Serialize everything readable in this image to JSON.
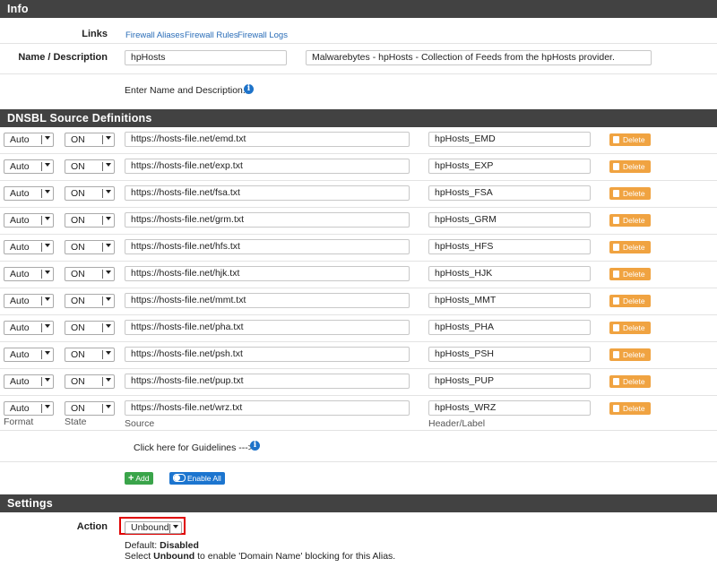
{
  "info": {
    "title": "Info",
    "links_label": "Links",
    "links": [
      "Firewall Aliases",
      "Firewall Rules",
      "Firewall Logs"
    ],
    "name_label": "Name / Description",
    "name_value": "hpHosts",
    "description_value": "Malwarebytes - hpHosts - Collection of Feeds from the hpHosts provider.",
    "hint": "Enter Name and Description.",
    "info_icon": "info-circle-icon"
  },
  "sources": {
    "title": "DNSBL Source Definitions",
    "delete_label": "Delete",
    "rows": [
      {
        "format": "Auto",
        "state": "ON",
        "url": "https://hosts-file.net/emd.txt",
        "label": "hpHosts_EMD"
      },
      {
        "format": "Auto",
        "state": "ON",
        "url": "https://hosts-file.net/exp.txt",
        "label": "hpHosts_EXP"
      },
      {
        "format": "Auto",
        "state": "ON",
        "url": "https://hosts-file.net/fsa.txt",
        "label": "hpHosts_FSA"
      },
      {
        "format": "Auto",
        "state": "ON",
        "url": "https://hosts-file.net/grm.txt",
        "label": "hpHosts_GRM"
      },
      {
        "format": "Auto",
        "state": "ON",
        "url": "https://hosts-file.net/hfs.txt",
        "label": "hpHosts_HFS"
      },
      {
        "format": "Auto",
        "state": "ON",
        "url": "https://hosts-file.net/hjk.txt",
        "label": "hpHosts_HJK"
      },
      {
        "format": "Auto",
        "state": "ON",
        "url": "https://hosts-file.net/mmt.txt",
        "label": "hpHosts_MMT"
      },
      {
        "format": "Auto",
        "state": "ON",
        "url": "https://hosts-file.net/pha.txt",
        "label": "hpHosts_PHA"
      },
      {
        "format": "Auto",
        "state": "ON",
        "url": "https://hosts-file.net/psh.txt",
        "label": "hpHosts_PSH"
      },
      {
        "format": "Auto",
        "state": "ON",
        "url": "https://hosts-file.net/pup.txt",
        "label": "hpHosts_PUP"
      },
      {
        "format": "Auto",
        "state": "ON",
        "url": "https://hosts-file.net/wrz.txt",
        "label": "hpHosts_WRZ"
      }
    ],
    "col_format": "Format",
    "col_state": "State",
    "col_source": "Source",
    "col_header": "Header/Label",
    "guidelines": "Click here for Guidelines --->",
    "add_label": "Add",
    "enable_all_label": "Enable All"
  },
  "settings": {
    "title": "Settings",
    "action_label": "Action",
    "action_value": "Unbound",
    "default_prefix": "Default: ",
    "default_value": "Disabled",
    "help_prefix": "Select ",
    "help_bold": "Unbound",
    "help_suffix": " to enable 'Domain Name' blocking for this Alias.",
    "highlight_color": "#e00000"
  },
  "colors": {
    "header_bg": "#424242",
    "delete_btn": "#f0a341",
    "add_btn": "#3aa44a",
    "enable_btn": "#1c75cf",
    "link": "#2a6db8"
  }
}
